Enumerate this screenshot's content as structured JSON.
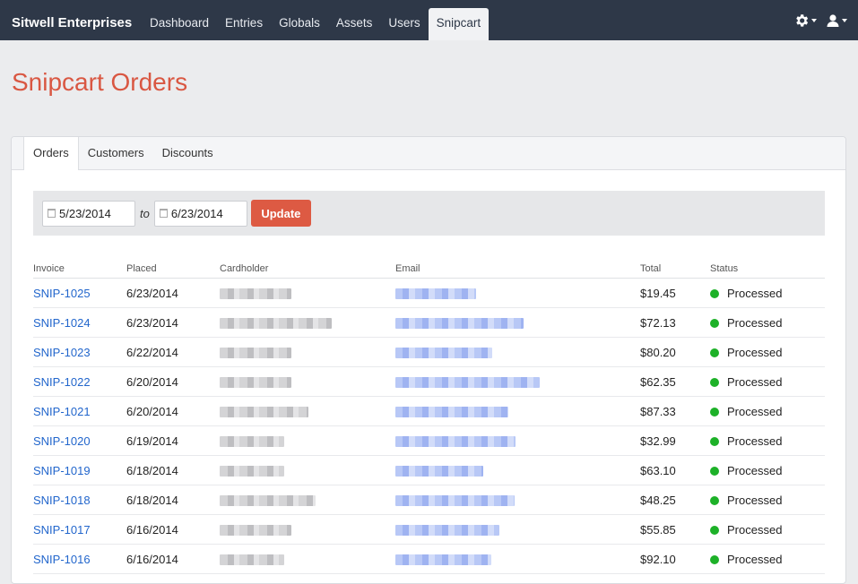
{
  "header": {
    "brand": "Sitwell Enterprises",
    "nav": [
      {
        "label": "Dashboard"
      },
      {
        "label": "Entries"
      },
      {
        "label": "Globals"
      },
      {
        "label": "Assets"
      },
      {
        "label": "Users"
      },
      {
        "label": "Snipcart",
        "active": true
      }
    ],
    "icons": [
      "gear-icon",
      "user-icon"
    ]
  },
  "page": {
    "title": "Snipcart Orders"
  },
  "tabs": [
    {
      "label": "Orders",
      "active": true
    },
    {
      "label": "Customers"
    },
    {
      "label": "Discounts"
    }
  ],
  "filter": {
    "from_date": "5/23/2014",
    "to_label": "to",
    "to_date": "6/23/2014",
    "update_label": "Update"
  },
  "table": {
    "columns": [
      "Invoice",
      "Placed",
      "Cardholder",
      "Email",
      "Total",
      "Status"
    ],
    "rows": [
      {
        "invoice": "SNIP-1025",
        "placed": "6/23/2014",
        "total": "$19.45",
        "status": "Processed"
      },
      {
        "invoice": "SNIP-1024",
        "placed": "6/23/2014",
        "total": "$72.13",
        "status": "Processed"
      },
      {
        "invoice": "SNIP-1023",
        "placed": "6/22/2014",
        "total": "$80.20",
        "status": "Processed"
      },
      {
        "invoice": "SNIP-1022",
        "placed": "6/20/2014",
        "total": "$62.35",
        "status": "Processed"
      },
      {
        "invoice": "SNIP-1021",
        "placed": "6/20/2014",
        "total": "$87.33",
        "status": "Processed"
      },
      {
        "invoice": "SNIP-1020",
        "placed": "6/19/2014",
        "total": "$32.99",
        "status": "Processed"
      },
      {
        "invoice": "SNIP-1019",
        "placed": "6/18/2014",
        "total": "$63.10",
        "status": "Processed"
      },
      {
        "invoice": "SNIP-1018",
        "placed": "6/18/2014",
        "total": "$48.25",
        "status": "Processed"
      },
      {
        "invoice": "SNIP-1017",
        "placed": "6/16/2014",
        "total": "$55.85",
        "status": "Processed"
      },
      {
        "invoice": "SNIP-1016",
        "placed": "6/16/2014",
        "total": "$92.10",
        "status": "Processed"
      }
    ]
  },
  "colors": {
    "accent": "#d95742",
    "topbar": "#2e3848",
    "link": "#2266cc",
    "status_processed": "#1db128"
  }
}
